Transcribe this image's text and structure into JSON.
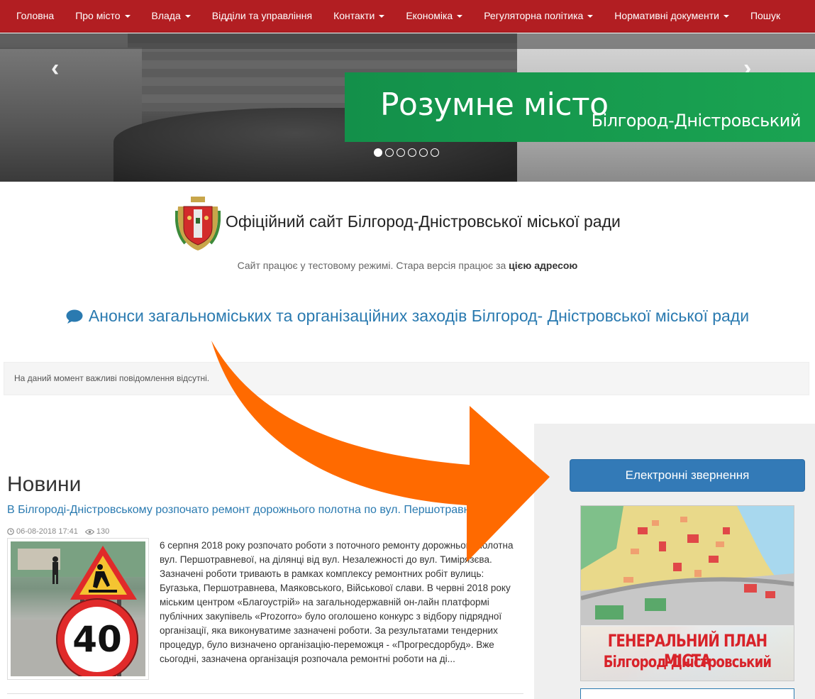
{
  "nav": {
    "items": [
      {
        "label": "Головна",
        "dropdown": false
      },
      {
        "label": "Про місто",
        "dropdown": true
      },
      {
        "label": "Влада",
        "dropdown": true
      },
      {
        "label": "Відділи та управління",
        "dropdown": false
      },
      {
        "label": "Контакти",
        "dropdown": true
      },
      {
        "label": "Економіка",
        "dropdown": true
      },
      {
        "label": "Регуляторна політика",
        "dropdown": true
      },
      {
        "label": "Нормативні документи",
        "dropdown": true
      },
      {
        "label": "Пошук",
        "dropdown": false
      }
    ],
    "background": "#b21e22"
  },
  "carousel": {
    "banner_title": "Розумне місто",
    "banner_subtitle": "Білгород-Дністровський",
    "slide_count": 6,
    "active_slide": 1,
    "banner_color": "#1aa452"
  },
  "header": {
    "site_title": "Офіційний сайт Білгород-Дністровської міської ради",
    "test_note_prefix": "Сайт працює у тестовому режимі. Стара версія працює за",
    "test_note_link": "цією адресою"
  },
  "announcements": {
    "heading": "Анонси загальноміських та організаційних заходів Білгород- Дністровської міської ради",
    "notice": "На даний момент важливі повідомлення відсутні."
  },
  "news": {
    "section_title": "Новини",
    "items": [
      {
        "title": "В Білгороді-Дністровському розпочато ремонт дорожнього полотна по вул. Першотравневій",
        "date": "06-08-2018 17:41",
        "views": "130",
        "sign_number": "40",
        "body": "6 серпня 2018 року розпочато роботи з поточного ремонту дорожнього полотна вул. Першотравневої, на ділянці від вул. Незалежності до вул. Тимірязєва. Зазначені роботи тривають в рамках комплексу ремонтних робіт вулиць: Бугазька, Першотравнева, Маяковського, Військової слави. В червні 2018 року міським центром «Благоустрій» на загальнодержавній он-лайн платформі публічних закупівель «Prozorro» було оголошено конкурс з відбору підрядної організації, яка виконуватиме зазначені роботи. За результатами тендерних процедур, було визначено організацію-переможця - «Прогресдорбуд». Вже сьогодні, зазначена організація розпочала ремонтні роботи на ді..."
      }
    ]
  },
  "sidebar": {
    "appeal_button": "Електронні звернення",
    "plan_title": "ГЕНЕРАЛЬНИЙ ПЛАН МІСТА",
    "plan_subtitle": "Білгород-Дністровський"
  },
  "colors": {
    "link": "#2a7ab0",
    "button": "#337ab7",
    "overlay_arrow": "#ff6a00"
  }
}
